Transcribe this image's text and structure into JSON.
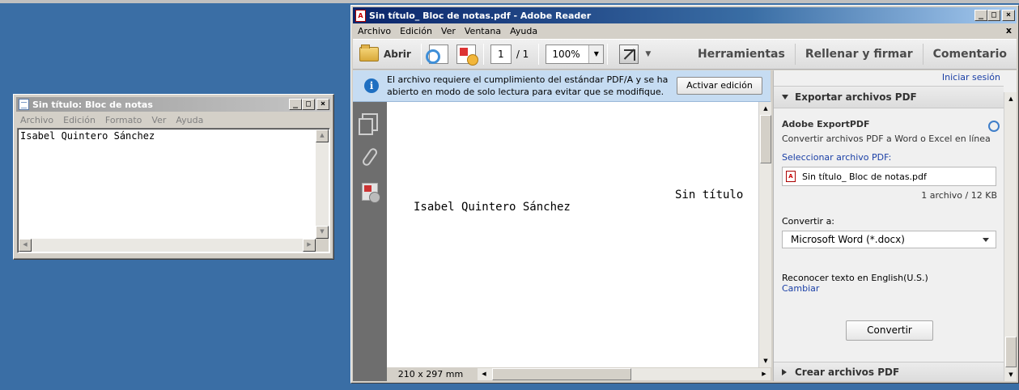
{
  "notepad": {
    "title": "Sin título: Bloc de notas",
    "menu": [
      "Archivo",
      "Edición",
      "Formato",
      "Ver",
      "Ayuda"
    ],
    "content": "Isabel Quintero Sánchez"
  },
  "reader": {
    "title": "Sin título_ Bloc de notas.pdf - Adobe Reader",
    "menu": [
      "Archivo",
      "Edición",
      "Ver",
      "Ventana",
      "Ayuda"
    ],
    "close_doc": "x",
    "toolbar": {
      "open_label": "Abrir",
      "page_current": "1",
      "page_total": "/ 1",
      "zoom": "100%",
      "tools_label": "Herramientas",
      "fill_sign_label": "Rellenar y firmar",
      "comment_label": "Comentario"
    },
    "infobar": {
      "message": "El archivo requiere el cumplimiento del estándar PDF/A y se ha abierto en modo de solo lectura para evitar que se modifique.",
      "button": "Activar edición"
    },
    "document": {
      "header_text": "Sin título",
      "body_text": "Isabel Quintero Sánchez",
      "page_size": "210 x 297 mm"
    },
    "right_pane": {
      "signin": "Iniciar sesión",
      "export_header": "Exportar archivos PDF",
      "export_title": "Adobe ExportPDF",
      "export_sub": "Convertir archivos PDF a Word o Excel en línea",
      "select_label": "Seleccionar archivo PDF:",
      "file_name": "Sin título_ Bloc de notas.pdf",
      "file_count": "1 archivo / 12 KB",
      "convert_to_label": "Convertir a:",
      "convert_to_value": "Microsoft Word (*.docx)",
      "ocr_label": "Reconocer texto en English(U.S.)",
      "ocr_change": "Cambiar",
      "convert_button": "Convertir",
      "create_header": "Crear archivos PDF"
    }
  }
}
